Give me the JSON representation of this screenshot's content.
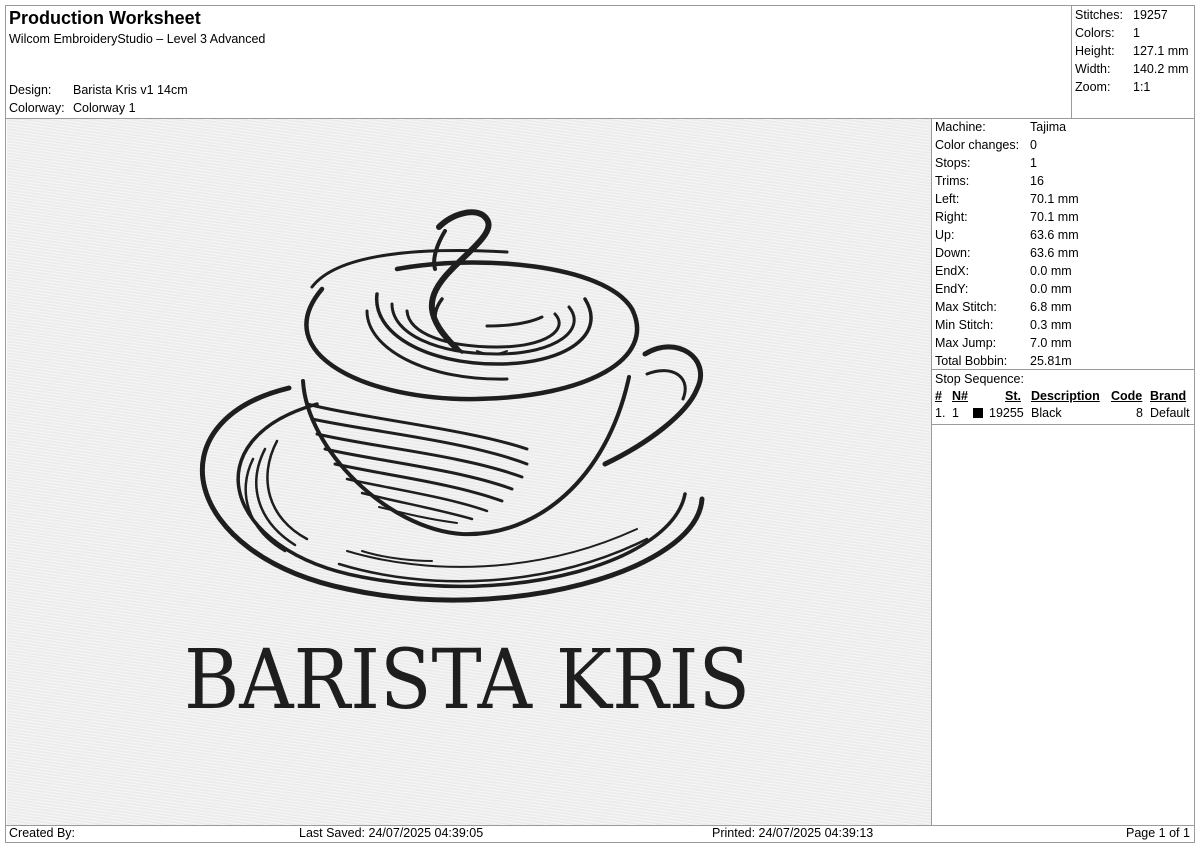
{
  "header": {
    "title": "Production Worksheet",
    "software": "Wilcom EmbroideryStudio – Level 3 Advanced",
    "design_label": "Design:",
    "design_value": "Barista Kris v1 14cm",
    "colorway_label": "Colorway:",
    "colorway_value": "Colorway 1"
  },
  "summary": [
    {
      "label": "Stitches:",
      "value": "19257"
    },
    {
      "label": "Colors:",
      "value": "1"
    },
    {
      "label": "Height:",
      "value": "127.1 mm"
    },
    {
      "label": "Width:",
      "value": "140.2 mm"
    },
    {
      "label": "Zoom:",
      "value": "1:1"
    }
  ],
  "machine_info": [
    {
      "label": "Machine:",
      "value": "Tajima"
    },
    {
      "label": "Color changes:",
      "value": "0"
    },
    {
      "label": "Stops:",
      "value": "1"
    },
    {
      "label": "Trims:",
      "value": "16"
    },
    {
      "label": "Left:",
      "value": "70.1 mm"
    },
    {
      "label": "Right:",
      "value": "70.1 mm"
    },
    {
      "label": "Up:",
      "value": "63.6 mm"
    },
    {
      "label": "Down:",
      "value": "63.6 mm"
    },
    {
      "label": "EndX:",
      "value": "0.0 mm"
    },
    {
      "label": "EndY:",
      "value": "0.0 mm"
    },
    {
      "label": "Max Stitch:",
      "value": "6.8 mm"
    },
    {
      "label": "Min Stitch:",
      "value": "0.3 mm"
    },
    {
      "label": "Max Jump:",
      "value": "7.0 mm"
    },
    {
      "label": "Total Bobbin:",
      "value": "25.81m"
    }
  ],
  "stop_sequence": {
    "label": "Stop Sequence:",
    "columns": [
      "#",
      "N#",
      "St.",
      "Description",
      "Code",
      "Brand"
    ],
    "rows": [
      {
        "num": "1.",
        "n": "1",
        "color": "#000000",
        "stitches": "19255",
        "description": "Black",
        "code": "8",
        "brand": "Default"
      }
    ]
  },
  "design_image": {
    "logo_text": "BARISTA KRIS",
    "thread_color": "#1e1e1e"
  },
  "footer": {
    "created_by": "Created By:",
    "last_saved": "Last Saved: 24/07/2025 04:39:05",
    "printed": "Printed: 24/07/2025 04:39:13",
    "page": "Page 1 of 1"
  }
}
